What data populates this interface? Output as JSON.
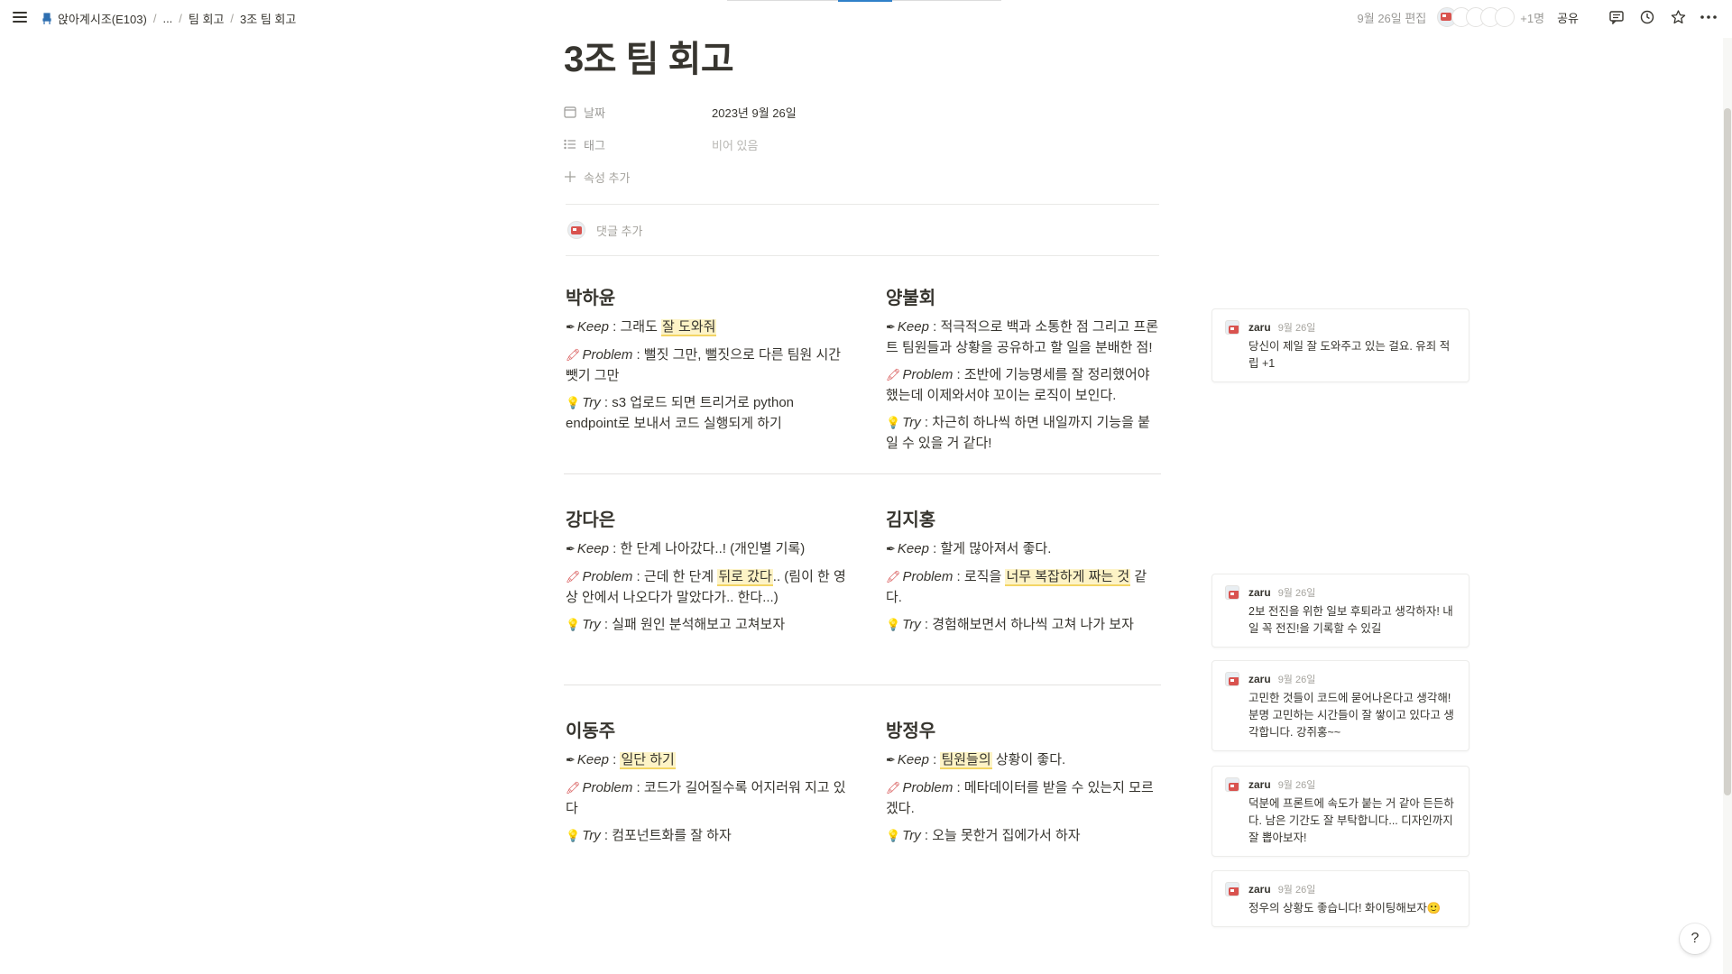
{
  "breadcrumb": {
    "workspace": "앉아계시조(E103)",
    "ellipsis": "...",
    "parent": "팀 회고",
    "current": "3조 팀 회고"
  },
  "topbar": {
    "edited": "9월 26일 편집",
    "extra_users": "+1명",
    "share": "공유"
  },
  "page": {
    "title": "3조 팀 회고",
    "properties": [
      {
        "icon": "calendar-icon",
        "label": "날짜",
        "value": "2023년 9월 26일"
      },
      {
        "icon": "list-icon",
        "label": "태그",
        "value": "비어 있음"
      }
    ],
    "add_property": "속성 추가",
    "add_comment": "댓글 추가"
  },
  "labels": {
    "keep": "Keep",
    "problem": "Problem",
    "try": "Try"
  },
  "members": [
    {
      "name": "박하윤",
      "keep": [
        "그래도 ",
        {
          "hl": "잘 도와줘"
        }
      ],
      "problem": [
        "뻘짓 그만, 뻘짓으로 다른 팀원 시간 뺏기 그만"
      ],
      "try": [
        "s3 업로드 되면 트리거로 python endpoint로 보내서 코드 실행되게 하기"
      ]
    },
    {
      "name": "양불회",
      "keep": [
        "적극적으로 백과 소통한 점 그리고 프론트 팀원들과 상황을 공유하고 할 일을 분배한 점!"
      ],
      "problem": [
        "조반에 기능명세를 잘 정리했어야 했는데 이제와서야 꼬이는 로직이 보인다."
      ],
      "try": [
        " 차근히 하나씩 하면 내일까지 기능을 붙일 수 있을 거 같다!"
      ]
    },
    {
      "name": "강다은",
      "keep": [
        "한 단계 나아갔다..! (개인별 기록)"
      ],
      "problem": [
        "근데 한 단계 ",
        {
          "hl": "뒤로 갔다"
        },
        ".. (림이 한 영상 안에서 나오다가 말았다가.. 한다...)"
      ],
      "try": [
        "실패 원인 분석해보고 고쳐보자"
      ]
    },
    {
      "name": "김지홍",
      "keep": [
        "할게 많아져서 좋다."
      ],
      "problem": [
        "로직을 ",
        {
          "hl": "너무 복잡하게 짜는 것"
        },
        " 같다."
      ],
      "try": [
        "경험해보면서 하나씩 고쳐 나가 보자"
      ]
    },
    {
      "name": "이동주",
      "keep": [
        {
          "hl": "일단 하기"
        }
      ],
      "problem": [
        "코드가 길어질수록 어지러워 지고 있다"
      ],
      "try": [
        "컴포넌트화를 잘 하자"
      ]
    },
    {
      "name": "방정우",
      "keep": [
        {
          "hl": "팀원들의"
        },
        " 상황이 좋다."
      ],
      "problem": [
        "메타데이터를 받을 수 있는지 모르겠다."
      ],
      "try": [
        "오늘 못한거 집에가서 하자"
      ]
    }
  ],
  "comments": [
    {
      "author": "zaru",
      "date": "9월 26일",
      "text": "당신이 제일 잘 도와주고 있는 걸요. 유죄 적립 +1"
    },
    {
      "author": "zaru",
      "date": "9월 26일",
      "text": "2보 전진을 위한 일보 후퇴라고 생각하자! 내일 꼭 전진!을 기록할 수 있길"
    },
    {
      "author": "zaru",
      "date": "9월 26일",
      "text": "고민한 것들이 코드에 묻어나온다고 생각해! 분명 고민하는 시간들이 잘 쌓이고 있다고 생각합니다. 강쥐홍~~"
    },
    {
      "author": "zaru",
      "date": "9월 26일",
      "text": "덕분에 프론트에 속도가 붙는 거 같아 든든하다. 남은 기간도 잘 부탁합니다... 디자인까지 잘 뽑아보자!"
    },
    {
      "author": "zaru",
      "date": "9월 26일",
      "text": "정우의 상황도 좋습니다! 화이팅해보자🙂"
    }
  ],
  "help": "?"
}
